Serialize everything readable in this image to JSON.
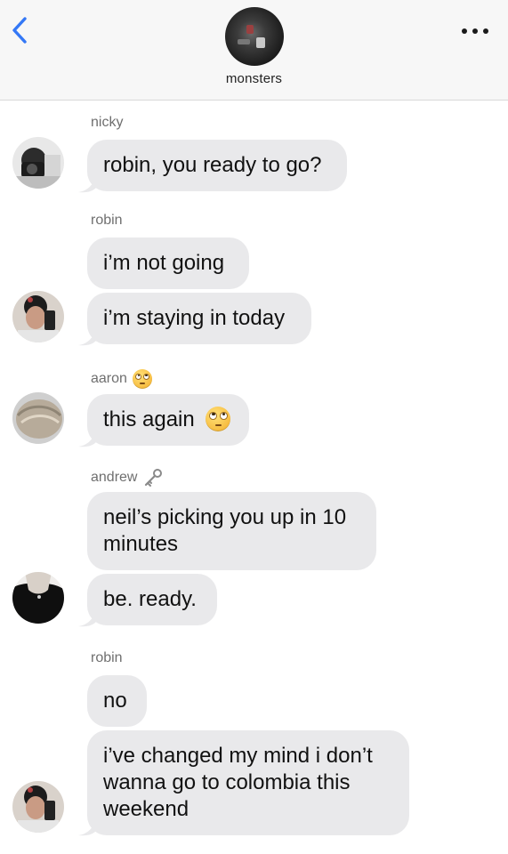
{
  "header": {
    "group_name": "monsters",
    "back_icon": "chevron-left-icon",
    "more_icon": "more-dots-icon",
    "accent_color": "#3478f6"
  },
  "messages": [
    {
      "sender": "nicky",
      "text": "robin, you ready to go?"
    },
    {
      "sender": "robin",
      "texts": [
        "i’m not going",
        "i’m staying in today"
      ]
    },
    {
      "sender": "aaron",
      "sender_icon": "face-with-rolling-eyes-emoji",
      "text": "this again",
      "text_icon": "face-with-rolling-eyes-emoji"
    },
    {
      "sender": "andrew",
      "sender_icon": "old-key-emoji",
      "texts": [
        "neil’s picking you up in 10 minutes",
        "be. ready."
      ]
    },
    {
      "sender": "robin",
      "texts": [
        "no",
        "i’ve changed my mind i don’t wanna go to colombia this weekend"
      ]
    }
  ],
  "colors": {
    "bubble": "#e9e9eb",
    "header_bg": "#f7f7f7",
    "sender_text": "#6f6f6f"
  }
}
